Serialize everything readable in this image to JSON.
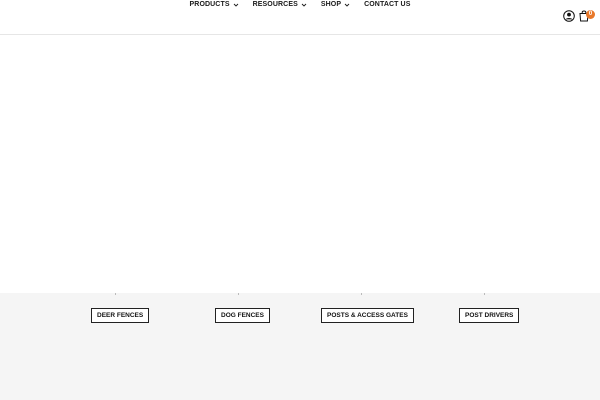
{
  "nav": {
    "items": [
      {
        "label": "PRODUCTS",
        "has_dropdown": true
      },
      {
        "label": "RESOURCES",
        "has_dropdown": true
      },
      {
        "label": "SHOP",
        "has_dropdown": true
      },
      {
        "label": "CONTACT US",
        "has_dropdown": false
      }
    ]
  },
  "header": {
    "user_icon": "user-circle-icon",
    "cart_icon": "shopping-bag-icon",
    "cart_count": "0",
    "accent_color": "#e8782a"
  },
  "categories": {
    "items": [
      {
        "label": "DEER FENCES"
      },
      {
        "label": "DOG FENCES"
      },
      {
        "label": "POSTS & ACCESS GATES"
      },
      {
        "label": "POST DRIVERS"
      }
    ]
  }
}
